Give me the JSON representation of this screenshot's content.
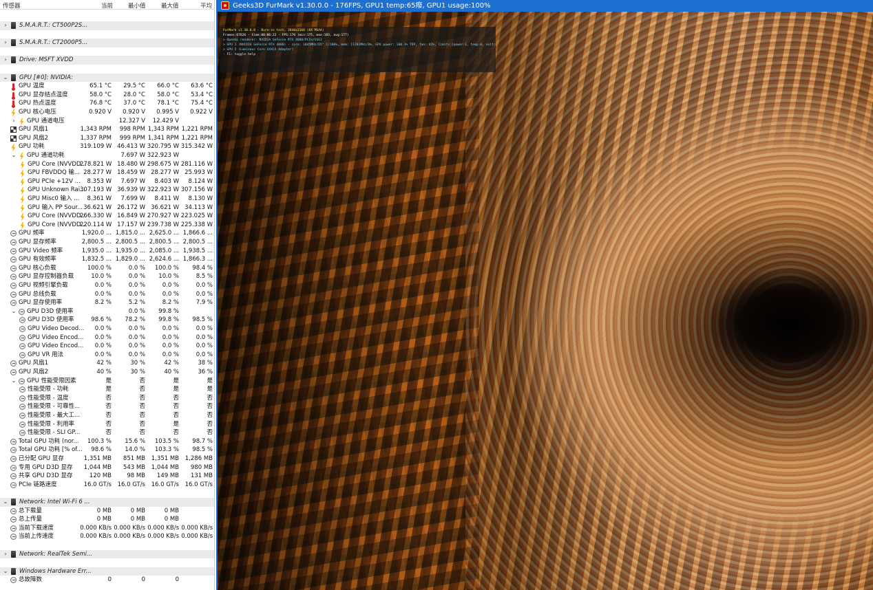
{
  "sensor_panel": {
    "columns": [
      "传感器",
      "当前",
      "最小值",
      "最大值",
      "平均"
    ],
    "rows": [
      {
        "type": "group",
        "tree": "›",
        "icon": "disk-icon",
        "label": "S.M.A.R.T.: CT500P2S..."
      },
      {
        "type": "gap"
      },
      {
        "type": "group",
        "tree": "›",
        "icon": "disk-icon",
        "label": "S.M.A.R.T.: CT2000P5..."
      },
      {
        "type": "gap"
      },
      {
        "type": "group",
        "tree": "›",
        "icon": "disk-icon",
        "label": "Drive: MSFT XVDD"
      },
      {
        "type": "gap"
      },
      {
        "type": "group",
        "tree": "⌄",
        "icon": "gpu-icon",
        "label": "GPU [#0]: NVIDIA:"
      },
      {
        "type": "item",
        "indent": 0,
        "icon": "thermometer-icon",
        "label": "GPU 温度",
        "cur": "65.1 °C",
        "min": "29.5 °C",
        "max": "66.0 °C",
        "avg": "63.6 °C"
      },
      {
        "type": "item",
        "indent": 0,
        "icon": "thermometer-icon",
        "label": "GPU 显存结点温度",
        "cur": "58.0 °C",
        "min": "28.0 °C",
        "max": "58.0 °C",
        "avg": "53.4 °C"
      },
      {
        "type": "item",
        "indent": 0,
        "icon": "thermometer-icon",
        "label": "GPU 热点温度",
        "cur": "76.8 °C",
        "min": "37.0 °C",
        "max": "78.1 °C",
        "avg": "75.4 °C"
      },
      {
        "type": "item",
        "indent": 0,
        "icon": "bolt-icon",
        "label": "GPU 核心电压",
        "cur": "0.920 V",
        "min": "0.920 V",
        "max": "0.995 V",
        "avg": "0.922 V"
      },
      {
        "type": "item",
        "indent": 1,
        "tree": "›",
        "icon": "bolt-icon",
        "label": "GPU 通道电压",
        "cur": "",
        "min": "12.327 V",
        "max": "12.429 V",
        "avg": ""
      },
      {
        "type": "item",
        "indent": 0,
        "icon": "fan-icon",
        "label": "GPU 风扇1",
        "cur": "1,343 RPM",
        "min": "998 RPM",
        "max": "1,343 RPM",
        "avg": "1,221 RPM"
      },
      {
        "type": "item",
        "indent": 0,
        "icon": "fan-icon",
        "label": "GPU 风扇2",
        "cur": "1,337 RPM",
        "min": "999 RPM",
        "max": "1,341 RPM",
        "avg": "1,221 RPM"
      },
      {
        "type": "item",
        "indent": 0,
        "icon": "bolt-icon",
        "label": "GPU 功耗",
        "cur": "319.109 W",
        "min": "46.413 W",
        "max": "320.795 W",
        "avg": "315.342 W"
      },
      {
        "type": "item",
        "indent": 1,
        "tree": "⌄",
        "icon": "bolt-icon",
        "label": "GPU 通道功耗",
        "cur": "",
        "min": "7.697 W",
        "max": "322.923 W",
        "avg": ""
      },
      {
        "type": "item",
        "indent": 2,
        "icon": "bolt-icon",
        "label": "GPU Core (NVVDD...",
        "cur": "278.821 W",
        "min": "18.480 W",
        "max": "298.675 W",
        "avg": "281.116 W"
      },
      {
        "type": "item",
        "indent": 2,
        "icon": "bolt-icon",
        "label": "GPU FBVDDQ 输...",
        "cur": "28.277 W",
        "min": "18.459 W",
        "max": "28.277 W",
        "avg": "25.993 W"
      },
      {
        "type": "item",
        "indent": 2,
        "icon": "bolt-icon",
        "label": "GPU PCIe +12V ...",
        "cur": "8.353 W",
        "min": "7.697 W",
        "max": "8.403 W",
        "avg": "8.124 W"
      },
      {
        "type": "item",
        "indent": 2,
        "icon": "bolt-icon",
        "label": "GPU Unknown Rai...",
        "cur": "307.193 W",
        "min": "36.939 W",
        "max": "322.923 W",
        "avg": "307.156 W"
      },
      {
        "type": "item",
        "indent": 2,
        "icon": "bolt-icon",
        "label": "GPU Misc0 输入 ...",
        "cur": "8.361 W",
        "min": "7.699 W",
        "max": "8.411 W",
        "avg": "8.130 W"
      },
      {
        "type": "item",
        "indent": 2,
        "icon": "bolt-icon",
        "label": "GPU 输入 PP Sour...",
        "cur": "36.621 W",
        "min": "26.172 W",
        "max": "36.621 W",
        "avg": "34.113 W"
      },
      {
        "type": "item",
        "indent": 2,
        "icon": "bolt-icon",
        "label": "GPU Core (NVVDD...",
        "cur": "266.330 W",
        "min": "16.849 W",
        "max": "270.927 W",
        "avg": "223.025 W"
      },
      {
        "type": "item",
        "indent": 2,
        "icon": "bolt-icon",
        "label": "GPU Core (NVVDD...",
        "cur": "220.114 W",
        "min": "17.157 W",
        "max": "239.738 W",
        "avg": "225.338 W"
      },
      {
        "type": "item",
        "indent": 0,
        "icon": "clock-icon",
        "label": "GPU 频率",
        "cur": "1,920.0 ...",
        "min": "1,815.0 ...",
        "max": "2,625.0 ...",
        "avg": "1,866.6 ..."
      },
      {
        "type": "item",
        "indent": 0,
        "icon": "clock-icon",
        "label": "GPU 显存频率",
        "cur": "2,800.5 ...",
        "min": "2,800.5 ...",
        "max": "2,800.5 ...",
        "avg": "2,800.5 ..."
      },
      {
        "type": "item",
        "indent": 0,
        "icon": "clock-icon",
        "label": "GPU Video 频率",
        "cur": "1,935.0 ...",
        "min": "1,935.0 ...",
        "max": "2,085.0 ...",
        "avg": "1,938.5 ..."
      },
      {
        "type": "item",
        "indent": 0,
        "icon": "clock-icon",
        "label": "GPU 有效频率",
        "cur": "1,832.5 ...",
        "min": "1,829.0 ...",
        "max": "2,624.6 ...",
        "avg": "1,866.3 ..."
      },
      {
        "type": "item",
        "indent": 0,
        "icon": "clock-icon",
        "label": "GPU 核心负载",
        "cur": "100.0 %",
        "min": "0.0 %",
        "max": "100.0 %",
        "avg": "98.4 %"
      },
      {
        "type": "item",
        "indent": 0,
        "icon": "clock-icon",
        "label": "GPU 显存控制器负载",
        "cur": "10.0 %",
        "min": "0.0 %",
        "max": "10.0 %",
        "avg": "8.5 %"
      },
      {
        "type": "item",
        "indent": 0,
        "icon": "clock-icon",
        "label": "GPU 视频引擎负载",
        "cur": "0.0 %",
        "min": "0.0 %",
        "max": "0.0 %",
        "avg": "0.0 %"
      },
      {
        "type": "item",
        "indent": 0,
        "icon": "clock-icon",
        "label": "GPU 总线负载",
        "cur": "0.0 %",
        "min": "0.0 %",
        "max": "0.0 %",
        "avg": "0.0 %"
      },
      {
        "type": "item",
        "indent": 0,
        "icon": "clock-icon",
        "label": "GPU 显存使用率",
        "cur": "8.2 %",
        "min": "5.2 %",
        "max": "8.2 %",
        "avg": "7.9 %"
      },
      {
        "type": "item",
        "indent": 1,
        "tree": "⌄",
        "icon": "clock-icon",
        "label": "GPU D3D 使用率",
        "cur": "",
        "min": "0.0 %",
        "max": "99.8 %",
        "avg": ""
      },
      {
        "type": "item",
        "indent": 2,
        "icon": "clock-icon",
        "label": "GPU D3D 使用率",
        "cur": "98.6 %",
        "min": "78.2 %",
        "max": "99.8 %",
        "avg": "98.5 %"
      },
      {
        "type": "item",
        "indent": 2,
        "icon": "clock-icon",
        "label": "GPU Video Decod...",
        "cur": "0.0 %",
        "min": "0.0 %",
        "max": "0.0 %",
        "avg": "0.0 %"
      },
      {
        "type": "item",
        "indent": 2,
        "icon": "clock-icon",
        "label": "GPU Video Encod...",
        "cur": "0.0 %",
        "min": "0.0 %",
        "max": "0.0 %",
        "avg": "0.0 %"
      },
      {
        "type": "item",
        "indent": 2,
        "icon": "clock-icon",
        "label": "GPU Video Encod...",
        "cur": "0.0 %",
        "min": "0.0 %",
        "max": "0.0 %",
        "avg": "0.0 %"
      },
      {
        "type": "item",
        "indent": 2,
        "icon": "clock-icon",
        "label": "GPU VR 用法",
        "cur": "0.0 %",
        "min": "0.0 %",
        "max": "0.0 %",
        "avg": "0.0 %"
      },
      {
        "type": "item",
        "indent": 0,
        "icon": "clock-icon",
        "label": "GPU 风扇1",
        "cur": "42 %",
        "min": "30 %",
        "max": "42 %",
        "avg": "38 %"
      },
      {
        "type": "item",
        "indent": 0,
        "icon": "clock-icon",
        "label": "GPU 风扇2",
        "cur": "40 %",
        "min": "30 %",
        "max": "40 %",
        "avg": "36 %"
      },
      {
        "type": "item",
        "indent": 1,
        "tree": "⌄",
        "icon": "clock-icon",
        "label": "GPU 性能受限因素",
        "cur": "是",
        "min": "否",
        "max": "是",
        "avg": "是"
      },
      {
        "type": "item",
        "indent": 2,
        "icon": "clock-icon",
        "label": "性能受限 - 功耗",
        "cur": "是",
        "min": "否",
        "max": "是",
        "avg": "是"
      },
      {
        "type": "item",
        "indent": 2,
        "icon": "clock-icon",
        "label": "性能受限 - 温度",
        "cur": "否",
        "min": "否",
        "max": "否",
        "avg": "否"
      },
      {
        "type": "item",
        "indent": 2,
        "icon": "clock-icon",
        "label": "性能受限 - 可靠性...",
        "cur": "否",
        "min": "否",
        "max": "否",
        "avg": "否"
      },
      {
        "type": "item",
        "indent": 2,
        "icon": "clock-icon",
        "label": "性能受限 - 最大工...",
        "cur": "否",
        "min": "否",
        "max": "否",
        "avg": "否"
      },
      {
        "type": "item",
        "indent": 2,
        "icon": "clock-icon",
        "label": "性能受限 - 利用率",
        "cur": "否",
        "min": "否",
        "max": "是",
        "avg": "否"
      },
      {
        "type": "item",
        "indent": 2,
        "icon": "clock-icon",
        "label": "性能受限 - SLI GP...",
        "cur": "否",
        "min": "否",
        "max": "否",
        "avg": "否"
      },
      {
        "type": "item",
        "indent": 0,
        "icon": "clock-icon",
        "label": "Total GPU 功耗 (nor...",
        "cur": "100.3 %",
        "min": "15.6 %",
        "max": "103.5 %",
        "avg": "98.7 %"
      },
      {
        "type": "item",
        "indent": 0,
        "icon": "clock-icon",
        "label": "Total GPU 功耗 [% of...",
        "cur": "98.6 %",
        "min": "14.0 %",
        "max": "103.3 %",
        "avg": "98.5 %"
      },
      {
        "type": "item",
        "indent": 0,
        "icon": "clock-icon",
        "label": "已分配 GPU 显存",
        "cur": "1,351 MB",
        "min": "851 MB",
        "max": "1,351 MB",
        "avg": "1,286 MB"
      },
      {
        "type": "item",
        "indent": 0,
        "icon": "clock-icon",
        "label": "专用 GPU D3D 显存",
        "cur": "1,044 MB",
        "min": "543 MB",
        "max": "1,044 MB",
        "avg": "980 MB"
      },
      {
        "type": "item",
        "indent": 0,
        "icon": "clock-icon",
        "label": "共享 GPU D3D 显存",
        "cur": "120 MB",
        "min": "98 MB",
        "max": "149 MB",
        "avg": "131 MB"
      },
      {
        "type": "item",
        "indent": 0,
        "icon": "clock-icon",
        "label": "PCIe 链路速度",
        "cur": "16.0 GT/s",
        "min": "16.0 GT/s",
        "max": "16.0 GT/s",
        "avg": "16.0 GT/s"
      },
      {
        "type": "gap"
      },
      {
        "type": "group",
        "tree": "⌄",
        "icon": "network-icon",
        "label": "Network: Intel Wi-Fi 6 ..."
      },
      {
        "type": "item",
        "indent": 0,
        "icon": "clock-icon",
        "label": "总下载量",
        "cur": "0 MB",
        "min": "0 MB",
        "max": "0 MB",
        "avg": ""
      },
      {
        "type": "item",
        "indent": 0,
        "icon": "clock-icon",
        "label": "总上传量",
        "cur": "0 MB",
        "min": "0 MB",
        "max": "0 MB",
        "avg": ""
      },
      {
        "type": "item",
        "indent": 0,
        "icon": "clock-icon",
        "label": "当前下载速度",
        "cur": "0.000 KB/s",
        "min": "0.000 KB/s",
        "max": "0.000 KB/s",
        "avg": "0.000 KB/s"
      },
      {
        "type": "item",
        "indent": 0,
        "icon": "clock-icon",
        "label": "当前上传速度",
        "cur": "0.000 KB/s",
        "min": "0.000 KB/s",
        "max": "0.000 KB/s",
        "avg": "0.000 KB/s"
      },
      {
        "type": "gap"
      },
      {
        "type": "group",
        "tree": "›",
        "icon": "network-icon",
        "label": "Network: RealTek Semi..."
      },
      {
        "type": "gap"
      },
      {
        "type": "group",
        "tree": "⌄",
        "icon": "windows-icon",
        "label": "Windows Hardware Err..."
      },
      {
        "type": "item",
        "indent": 0,
        "icon": "clock-icon",
        "label": "总故障数",
        "cur": "0",
        "min": "0",
        "max": "0",
        "avg": ""
      }
    ]
  },
  "furmark": {
    "title": "Geeks3D FurMark v1.30.0.0 - 176FPS, GPU1 temp:65癈, GPU1 usage:100%",
    "title_bar_color": "#1d6fd0",
    "osd": [
      "FurMark v1.30.0.0 - Burn-in test, 3840x2160 (8X MSAA)",
      "Frames:67626 - time:00:06:22 - FPS:176 (min:175, max:183, avg:177)",
      "> OpenGL renderer: NVIDIA GeForce RTX 4080/PCIe/SSE2",
      "> GPU 1 (NVIDIA GeForce RTX 4080) - core: 1845MHz/65° C/100%, mem: 11201MHz/8%, GPU power: 100.1% TDP, fan: 42%, limits:[power:1, temp:0, volt:0, OV:0]",
      "> GPU 2 (Luminous Core XXXCX Adapter)",
      "- F1: toggle help"
    ]
  }
}
